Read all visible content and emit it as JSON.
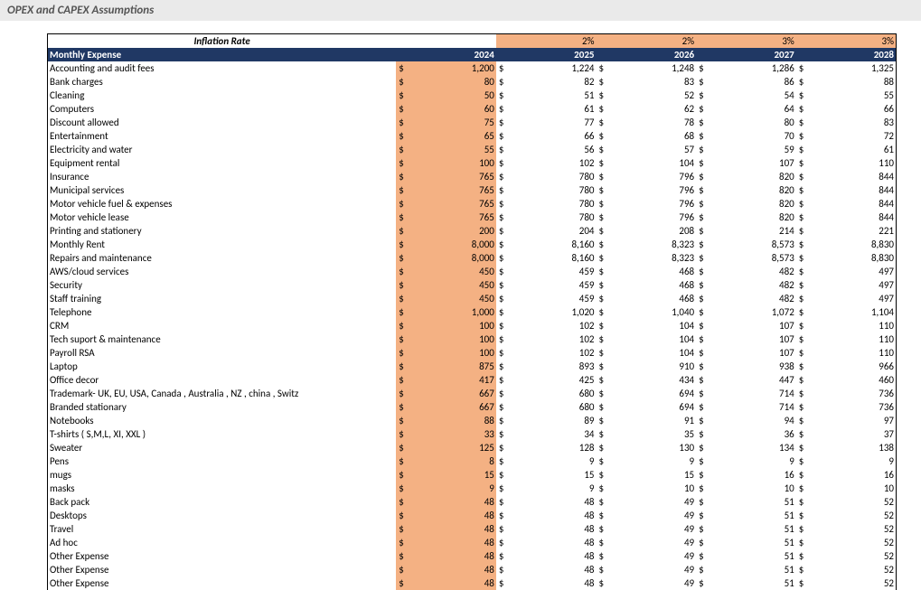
{
  "title": "OPEX and CAPEX Assumptions",
  "inflation_label": "Inflation Rate",
  "header_label": "Monthly Expense",
  "years": [
    "2024",
    "2025",
    "2026",
    "2027",
    "2028"
  ],
  "inflation_rates": [
    "",
    "2%",
    "2%",
    "3%",
    "3%"
  ],
  "currency": "$",
  "rows": [
    {
      "label": "Accounting and audit fees",
      "v": [
        "1,200",
        "1,224",
        "1,248",
        "1,286",
        "1,325"
      ]
    },
    {
      "label": "Bank charges",
      "v": [
        "80",
        "82",
        "83",
        "86",
        "88"
      ]
    },
    {
      "label": "Cleaning",
      "v": [
        "50",
        "51",
        "52",
        "54",
        "55"
      ]
    },
    {
      "label": "Computers",
      "v": [
        "60",
        "61",
        "62",
        "64",
        "66"
      ]
    },
    {
      "label": "Discount allowed",
      "v": [
        "75",
        "77",
        "78",
        "80",
        "83"
      ]
    },
    {
      "label": "Entertainment",
      "v": [
        "65",
        "66",
        "68",
        "70",
        "72"
      ]
    },
    {
      "label": "Electricity and water",
      "v": [
        "55",
        "56",
        "57",
        "59",
        "61"
      ]
    },
    {
      "label": "Equipment rental",
      "v": [
        "100",
        "102",
        "104",
        "107",
        "110"
      ]
    },
    {
      "label": "Insurance",
      "v": [
        "765",
        "780",
        "796",
        "820",
        "844"
      ]
    },
    {
      "label": "Municipal services",
      "v": [
        "765",
        "780",
        "796",
        "820",
        "844"
      ]
    },
    {
      "label": "Motor vehicle fuel & expenses",
      "v": [
        "765",
        "780",
        "796",
        "820",
        "844"
      ]
    },
    {
      "label": "Motor vehicle lease",
      "v": [
        "765",
        "780",
        "796",
        "820",
        "844"
      ]
    },
    {
      "label": "Printing and stationery",
      "v": [
        "200",
        "204",
        "208",
        "214",
        "221"
      ]
    },
    {
      "label": "Monthly Rent",
      "v": [
        "8,000",
        "8,160",
        "8,323",
        "8,573",
        "8,830"
      ]
    },
    {
      "label": "Repairs and maintenance",
      "v": [
        "8,000",
        "8,160",
        "8,323",
        "8,573",
        "8,830"
      ]
    },
    {
      "label": "AWS/cloud services",
      "v": [
        "450",
        "459",
        "468",
        "482",
        "497"
      ]
    },
    {
      "label": "Security",
      "v": [
        "450",
        "459",
        "468",
        "482",
        "497"
      ]
    },
    {
      "label": "Staff training",
      "v": [
        "450",
        "459",
        "468",
        "482",
        "497"
      ]
    },
    {
      "label": "Telephone",
      "v": [
        "1,000",
        "1,020",
        "1,040",
        "1,072",
        "1,104"
      ]
    },
    {
      "label": "CRM",
      "v": [
        "100",
        "102",
        "104",
        "107",
        "110"
      ]
    },
    {
      "label": "Tech suport & maintenance",
      "v": [
        "100",
        "102",
        "104",
        "107",
        "110"
      ]
    },
    {
      "label": "Payroll RSA",
      "v": [
        "100",
        "102",
        "104",
        "107",
        "110"
      ]
    },
    {
      "label": "Laptop",
      "v": [
        "875",
        "893",
        "910",
        "938",
        "966"
      ]
    },
    {
      "label": "Office decor",
      "v": [
        "417",
        "425",
        "434",
        "447",
        "460"
      ]
    },
    {
      "label": "Trademark- UK, EU, USA, Canada , Australia , NZ , china , Switz",
      "v": [
        "667",
        "680",
        "694",
        "714",
        "736"
      ]
    },
    {
      "label": "Branded stationary",
      "v": [
        "667",
        "680",
        "694",
        "714",
        "736"
      ]
    },
    {
      "label": "Notebooks",
      "v": [
        "88",
        "89",
        "91",
        "94",
        "97"
      ]
    },
    {
      "label": "T-shirts ( S,M,L, XI, XXL )",
      "v": [
        "33",
        "34",
        "35",
        "36",
        "37"
      ]
    },
    {
      "label": "Sweater",
      "v": [
        "125",
        "128",
        "130",
        "134",
        "138"
      ]
    },
    {
      "label": "Pens",
      "v": [
        "8",
        "9",
        "9",
        "9",
        "9"
      ]
    },
    {
      "label": "mugs",
      "v": [
        "15",
        "15",
        "15",
        "16",
        "16"
      ]
    },
    {
      "label": "masks",
      "v": [
        "9",
        "9",
        "10",
        "10",
        "10"
      ]
    },
    {
      "label": "Back pack",
      "v": [
        "48",
        "48",
        "49",
        "51",
        "52"
      ]
    },
    {
      "label": "Desktops",
      "v": [
        "48",
        "48",
        "49",
        "51",
        "52"
      ]
    },
    {
      "label": "Travel",
      "v": [
        "48",
        "48",
        "49",
        "51",
        "52"
      ]
    },
    {
      "label": "Ad hoc",
      "v": [
        "48",
        "48",
        "49",
        "51",
        "52"
      ]
    },
    {
      "label": "Other Expense",
      "v": [
        "48",
        "48",
        "49",
        "51",
        "52"
      ]
    },
    {
      "label": "Other Expense",
      "v": [
        "48",
        "48",
        "49",
        "51",
        "52"
      ]
    },
    {
      "label": "Other Expense",
      "v": [
        "48",
        "48",
        "49",
        "51",
        "52"
      ]
    }
  ]
}
